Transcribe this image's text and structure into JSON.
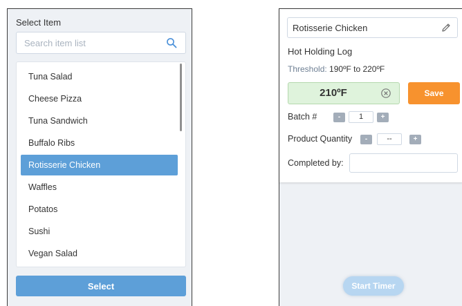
{
  "left": {
    "title": "Select Item",
    "search": {
      "placeholder": "Search item list",
      "icon": "search-icon"
    },
    "items": [
      {
        "label": "Tuna Salad",
        "selected": false
      },
      {
        "label": "Cheese Pizza",
        "selected": false
      },
      {
        "label": "Tuna Sandwich",
        "selected": false
      },
      {
        "label": "Buffalo Ribs",
        "selected": false
      },
      {
        "label": "Rotisserie Chicken",
        "selected": true
      },
      {
        "label": "Waffles",
        "selected": false
      },
      {
        "label": "Potatos",
        "selected": false
      },
      {
        "label": "Sushi",
        "selected": false
      },
      {
        "label": "Vegan Salad",
        "selected": false
      }
    ],
    "select_label": "Select"
  },
  "right": {
    "item_name": "Rotisserie Chicken",
    "edit_icon": "pencil-icon",
    "log_title": "Hot Holding Log",
    "threshold_label": "Threshold:",
    "threshold_value": "190ºF to 220ºF",
    "temperature": "210ºF",
    "clear_icon": "clear-circle-icon",
    "save_label": "Save",
    "batch": {
      "label": "Batch #",
      "minus": "-",
      "value": "1",
      "plus": "+"
    },
    "quantity": {
      "label": "Product Quantity",
      "minus": "-",
      "value": "--",
      "plus": "+"
    },
    "completed_by_label": "Completed by:",
    "completed_by_value": "",
    "start_timer_label": "Start Timer"
  },
  "colors": {
    "accent_blue": "#5d9fd8",
    "save_orange": "#f7922e",
    "temp_green_bg": "#dff3dc",
    "panel_bg": "#eef1f5",
    "stepper_gray": "#a3adb9",
    "start_timer_disabled": "#b7d6f1"
  }
}
